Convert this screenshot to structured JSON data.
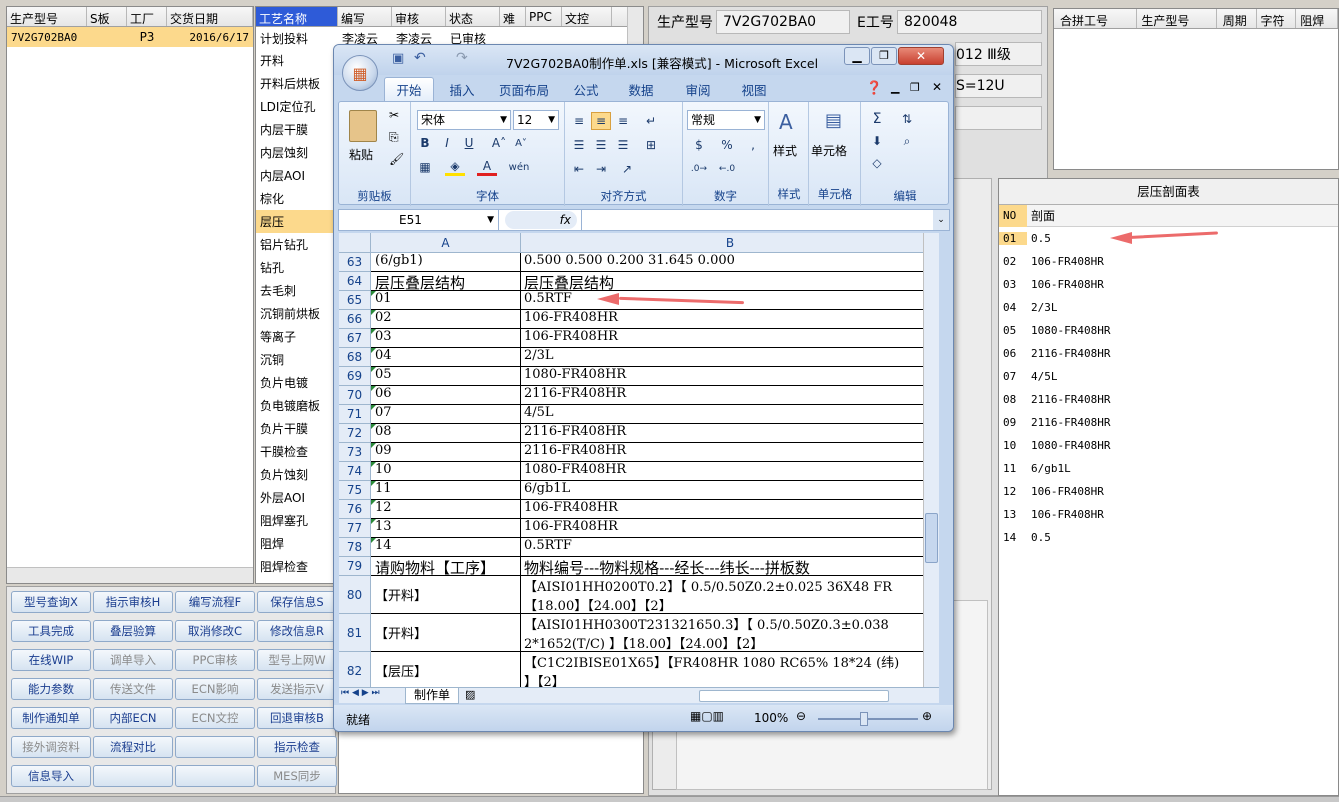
{
  "left_grid": {
    "headers": [
      "生产型号",
      "S板",
      "工厂",
      "交货日期"
    ],
    "row": [
      "7V2G702BA0",
      "",
      "P3",
      "2016/6/17"
    ]
  },
  "process_grid": {
    "headers": [
      "工艺名称",
      "编写",
      "审核",
      "状态",
      "难",
      "PPC",
      "文控"
    ],
    "first_row": [
      "计划投料",
      "李凌云",
      "李凌云",
      "已审核"
    ],
    "items": [
      "开料",
      "开料后烘板",
      "LDI定位孔",
      "内层干膜",
      "内层蚀刻",
      "内层AOI",
      "棕化",
      "层压",
      "铝片钻孔",
      "钻孔",
      "去毛刺",
      "沉铜前烘板",
      "等离子",
      "沉铜",
      "负片电镀",
      "负电镀磨板",
      "负片干膜",
      "干膜检查",
      "负片蚀刻",
      "外层AOI",
      "阻焊塞孔",
      "阻焊",
      "阻焊检查"
    ]
  },
  "buttons": [
    [
      "型号查询X",
      "指示审核H",
      "编写流程F",
      "保存信息S"
    ],
    [
      "工具完成",
      "叠层验算",
      "取消修改C",
      "修改信息R"
    ],
    [
      "在线WIP",
      "调单导入",
      "PPC审核",
      "型号上网W"
    ],
    [
      "能力参数",
      "传送文件",
      "ECN影响",
      "发送指示V"
    ],
    [
      "制作通知单",
      "内部ECN",
      "ECN文控",
      "回退审核B"
    ],
    [
      "接外调资料",
      "流程对比",
      "",
      "指示检查"
    ],
    [
      "信息导入",
      "",
      "",
      "MES同步"
    ]
  ],
  "buttons_disabled": [
    [
      false,
      false,
      false,
      false
    ],
    [
      false,
      false,
      false,
      false
    ],
    [
      false,
      true,
      true,
      true
    ],
    [
      false,
      true,
      true,
      true
    ],
    [
      false,
      false,
      true,
      false
    ],
    [
      true,
      false,
      false,
      false
    ],
    [
      false,
      false,
      false,
      true
    ]
  ],
  "info": {
    "prod_label": "生产型号",
    "prod_value": "7V2G702BA0",
    "e_label": "E工号",
    "e_value": "820048",
    "line2": "012 Ⅲ级",
    "line3": "S=12U"
  },
  "merge_grid": {
    "headers": [
      "合拼工号",
      "生产型号",
      "周期",
      "字符",
      "阻焊"
    ]
  },
  "lamination": {
    "title": "层压剖面表",
    "col_no": "NO",
    "col_section": "剖面",
    "rows": [
      [
        "01",
        "0.5"
      ],
      [
        "02",
        "106-FR408HR"
      ],
      [
        "03",
        "106-FR408HR"
      ],
      [
        "04",
        "2/3L"
      ],
      [
        "05",
        "1080-FR408HR"
      ],
      [
        "06",
        "2116-FR408HR"
      ],
      [
        "07",
        "4/5L"
      ],
      [
        "08",
        "2116-FR408HR"
      ],
      [
        "09",
        "2116-FR408HR"
      ],
      [
        "10",
        "1080-FR408HR"
      ],
      [
        "11",
        "6/gb1L"
      ],
      [
        "12",
        "106-FR408HR"
      ],
      [
        "13",
        "106-FR408HR"
      ],
      [
        "14",
        "0.5"
      ]
    ]
  },
  "excel": {
    "title": "7V2G702BA0制作单.xls [兼容模式] - Microsoft Excel",
    "tabs": [
      "开始",
      "插入",
      "页面布局",
      "公式",
      "数据",
      "审阅",
      "视图"
    ],
    "font_name": "宋体",
    "font_size": "12",
    "number_format": "常规",
    "group_labels": [
      "剪贴板",
      "字体",
      "对齐方式",
      "数字",
      "样式",
      "单元格",
      "编辑"
    ],
    "paste": "粘贴",
    "styles": "样式",
    "cells": "单元格",
    "name_box": "E51",
    "fx": "fx",
    "col_a": "A",
    "col_b": "B",
    "rows": [
      [
        "63",
        "(6/gb1)",
        "0.500   0.500             0.200        31.645     0.000"
      ],
      [
        "64",
        "层压叠层结构",
        "层压叠层结构"
      ],
      [
        "65",
        "01",
        "0.5RTF"
      ],
      [
        "66",
        "02",
        "106-FR408HR"
      ],
      [
        "67",
        "03",
        "106-FR408HR"
      ],
      [
        "68",
        "04",
        "2/3L"
      ],
      [
        "69",
        "05",
        "1080-FR408HR"
      ],
      [
        "70",
        "06",
        "2116-FR408HR"
      ],
      [
        "71",
        "07",
        "4/5L"
      ],
      [
        "72",
        "08",
        "2116-FR408HR"
      ],
      [
        "73",
        "09",
        "2116-FR408HR"
      ],
      [
        "74",
        "10",
        "1080-FR408HR"
      ],
      [
        "75",
        "11",
        "6/gb1L"
      ],
      [
        "76",
        "12",
        "106-FR408HR"
      ],
      [
        "77",
        "13",
        "106-FR408HR"
      ],
      [
        "78",
        "14",
        "0.5RTF"
      ],
      [
        "79",
        "请购物料【工序】",
        "物料编号---物料规格---经长---纬长---拼板数"
      ]
    ],
    "row80": {
      "num": "80",
      "a": "【开料】",
      "b1": "【AISI01HH0200T0.2】【 0.5/0.50Z0.2±0.025 36X48  FR",
      "b2": "【18.00】【24.00】【2】"
    },
    "row81": {
      "num": "81",
      "a": "【开料】",
      "b1": "【AISI01HH0300T231321650.3】【 0.5/0.50Z0.3±0.038",
      "b2": "2*1652(T/C) 】【18.00】【24.00】【2】"
    },
    "row82": {
      "num": "82",
      "a": "【层压】",
      "b1": "【C1C2IBISE01X65】【FR408HR 1080 RC65% 18*24 (纬) ",
      "b2": "】【2】"
    },
    "sheet_tab": "制作单",
    "status": "就绪",
    "zoom": "100%"
  }
}
